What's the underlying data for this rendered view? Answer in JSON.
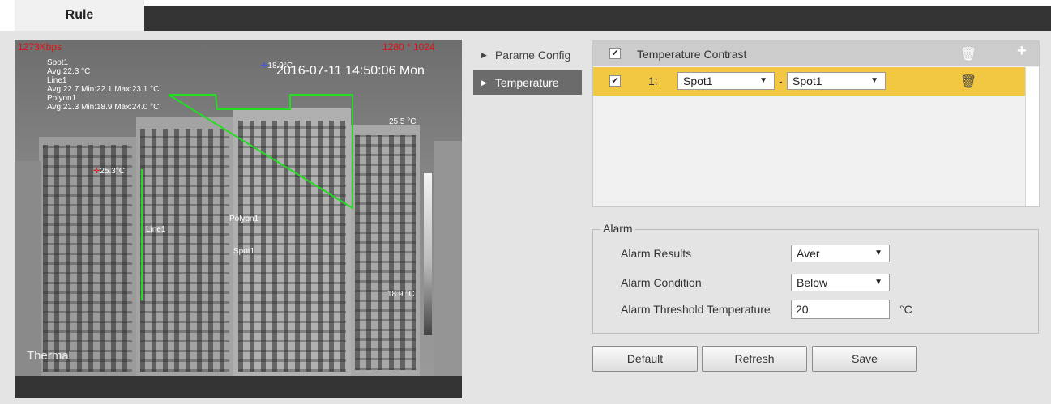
{
  "header": {
    "tab_label": "Rule"
  },
  "video": {
    "bitrate": "1273Kbps",
    "resolution": "1280 * 1024",
    "timestamp": "2016-07-11 14:50:06 Mon",
    "thermal_label": "Thermal",
    "readings": {
      "spot_title": "Spot1",
      "spot_avg": "Avg:22.3 °C",
      "line_title": "Line1",
      "line_stats": "Avg:22.7 Min:22.1 Max:23.1 °C",
      "polygon_title": "Polyon1",
      "polygon_stats": "Avg:21.3 Min:18.9 Max:24.0 °C"
    },
    "markers": {
      "blue_marker": "18.9°C",
      "red_marker": "25.3°C"
    },
    "scale": {
      "max": "25.5 °C",
      "min": "18.9 °C"
    },
    "labels": {
      "line": "Line1",
      "polygon": "Polyon1",
      "spot": "Spot1"
    }
  },
  "menu": {
    "items": [
      {
        "label": "Parame Config",
        "active": false
      },
      {
        "label": "Temperature",
        "active": true
      }
    ]
  },
  "contrast_table": {
    "header_label": "Temperature Contrast",
    "header_checked": true,
    "rows": [
      {
        "index": "1:",
        "checked": true,
        "source_a": "Spot1",
        "separator": "-",
        "source_b": "Spot1"
      }
    ]
  },
  "alarm": {
    "legend": "Alarm",
    "results_label": "Alarm Results",
    "results_value": "Aver",
    "condition_label": "Alarm Condition",
    "condition_value": "Below",
    "threshold_label": "Alarm Threshold Temperature",
    "threshold_value": "20",
    "threshold_unit": "°C"
  },
  "buttons": {
    "default": "Default",
    "refresh": "Refresh",
    "save": "Save"
  },
  "colors": {
    "active_row": "#f2c843",
    "active_menu": "#6b6b6b",
    "overlay_green": "#22dd22",
    "overlay_red": "#e01010"
  },
  "icons": {
    "checkbox": "check-icon",
    "delete": "trash-icon",
    "add": "plus-icon",
    "menu_arrow": "triangle-right-icon"
  }
}
